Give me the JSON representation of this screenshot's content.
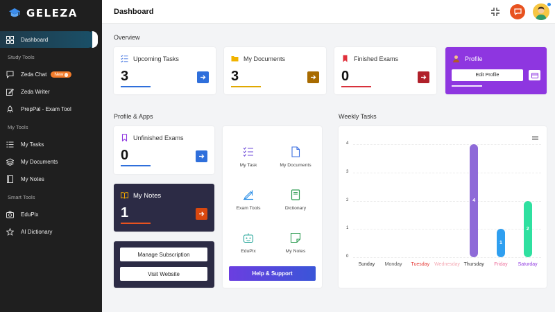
{
  "brand": {
    "name": "GELEZA"
  },
  "sidebar": {
    "active": "Dashboard",
    "sections": [
      {
        "label": "Study Tools"
      },
      {
        "label": "My Tools"
      },
      {
        "label": "Smart Tools"
      }
    ],
    "items": {
      "dashboard": "Dashboard",
      "zeda_chat": "Zeda Chat",
      "zeda_chat_badge": "New",
      "zeda_writer": "Zeda Writer",
      "preppal": "PrepPal - Exam Tool",
      "my_tasks": "My Tasks",
      "my_documents": "My Documents",
      "my_notes": "My Notes",
      "edupix": "EduPix",
      "ai_dictionary": "AI Dictionary"
    }
  },
  "header": {
    "title": "Dashboard"
  },
  "overview": {
    "label": "Overview",
    "cards": [
      {
        "title": "Upcoming Tasks",
        "value": "3",
        "color": "#2f6fdb"
      },
      {
        "title": "My Documents",
        "value": "3",
        "color": "#e0a800"
      },
      {
        "title": "Finished Exams",
        "value": "0",
        "color": "#d8313b"
      }
    ],
    "profile": {
      "title": "Profile",
      "button": "Edit Profile"
    }
  },
  "profile_apps": {
    "label": "Profile & Apps",
    "unfinished": {
      "title": "Unfinished Exams",
      "value": "0"
    },
    "notes": {
      "title": "My Notes",
      "value": "1"
    },
    "manage_subscription": "Manage Subscription",
    "visit_website": "Visit Website",
    "apps": [
      {
        "label": "My Task"
      },
      {
        "label": "My Documents"
      },
      {
        "label": "Exam Tools"
      },
      {
        "label": "Dictionary"
      },
      {
        "label": "EduPix"
      },
      {
        "label": "My Notes"
      }
    ],
    "help": "Help & Support"
  },
  "weekly": {
    "label": "Weekly Tasks",
    "chart_data": {
      "type": "bar",
      "title": "Weekly Tasks",
      "categories": [
        "Sunday",
        "Monday",
        "Tuesday",
        "Wednesday",
        "Thursday",
        "Friday",
        "Saturday"
      ],
      "values": [
        0,
        0,
        0,
        0,
        4,
        1,
        2
      ],
      "category_colors": [
        "#333333",
        "#555555",
        "#e53935",
        "#f4a7b2",
        "#333333",
        "#ec6f9c",
        "#8e36e0"
      ],
      "bar_colors": [
        "#8e44ad",
        "#8e44ad",
        "#8e44ad",
        "#8e44ad",
        "#8e6ad8",
        "#2f9ff0",
        "#2fe0a0"
      ],
      "ylim": [
        0,
        4
      ],
      "yticks": [
        0,
        1,
        2,
        3,
        4
      ],
      "grid": true
    }
  }
}
